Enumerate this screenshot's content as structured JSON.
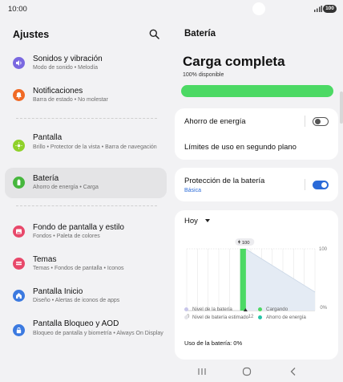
{
  "status_bar": {
    "time": "10:00",
    "battery": "100",
    "icons": [
      "camera-hole",
      "signal-icon",
      "battery-icon"
    ]
  },
  "left": {
    "title": "Ajustes",
    "search_icon": "search-icon",
    "items": [
      {
        "title": "Sonidos y vibración",
        "subtitle": "Modo de sonido • Melodía",
        "icon": "volume-icon",
        "color": "#7a68e0"
      },
      {
        "title": "Notificaciones",
        "subtitle": "Barra de estado • No molestar",
        "icon": "bell-icon",
        "color": "#f06a26"
      },
      {
        "title": "Pantalla",
        "subtitle": "Brillo • Protector de la vista • Barra de navegación",
        "icon": "sun-icon",
        "color": "#8fd12a"
      },
      {
        "title": "Batería",
        "subtitle": "Ahorro de energía • Carga",
        "icon": "battery-icon",
        "color": "#46b73d"
      },
      {
        "title": "Fondo de pantalla y estilo",
        "subtitle": "Fondos • Paleta de colores",
        "icon": "image-icon",
        "color": "#e8486a"
      },
      {
        "title": "Temas",
        "subtitle": "Temas • Fondos de pantalla • Iconos",
        "icon": "palette-icon",
        "color": "#e8486a"
      },
      {
        "title": "Pantalla Inicio",
        "subtitle": "Diseño • Alertas de iconos de apps",
        "icon": "home-icon",
        "color": "#3c7ae0"
      },
      {
        "title": "Pantalla Bloqueo y AOD",
        "subtitle": "Bloqueo de pantalla y biometría • Always On Display",
        "icon": "lock-icon",
        "color": "#3c7ae0"
      }
    ]
  },
  "right": {
    "title": "Batería",
    "charge_title": "Carga completa",
    "charge_subtitle": "100% disponible",
    "charge_level": 1.0,
    "accent_green": "#4cd964",
    "accent_blue": "#2a6ad8",
    "power_saving": {
      "label": "Ahorro de energía",
      "enabled": false
    },
    "usage_limits": {
      "label": "Límites de uso en segundo plano"
    },
    "protection": {
      "label": "Protección de la batería",
      "sublabel": "Básica",
      "enabled": true
    },
    "chart": {
      "period": "Hoy",
      "badge": "100",
      "x_start": "0",
      "x_mid": "12",
      "y_top": "100",
      "y_bottom": "0%",
      "legend": [
        {
          "label": "Nivel de la batería",
          "color": "#c8c6ea"
        },
        {
          "label": "Cargando",
          "color": "#4cd964"
        },
        {
          "label": "Nivel de batería estimado",
          "color": "#e3e3e8"
        },
        {
          "label": "Ahorro de energía",
          "color": "#27c4a8"
        }
      ],
      "usage_text": "Uso de la batería: 0%"
    }
  },
  "chart_data": {
    "type": "bar",
    "title": "",
    "x": [
      10,
      10.25,
      10.5,
      10.75
    ],
    "values": [
      100,
      100,
      100,
      100
    ],
    "series": [
      {
        "values": [
          100,
          100,
          100,
          100
        ]
      }
    ],
    "ylim": [
      0,
      100
    ],
    "xlim": [
      0,
      24
    ],
    "estimated_line": {
      "from": [
        11,
        100
      ],
      "to": [
        24,
        30
      ]
    },
    "current_time_marker": 11,
    "grid": true
  },
  "navbar": {
    "icons": [
      "recents-icon",
      "home-button-icon",
      "back-icon"
    ]
  }
}
